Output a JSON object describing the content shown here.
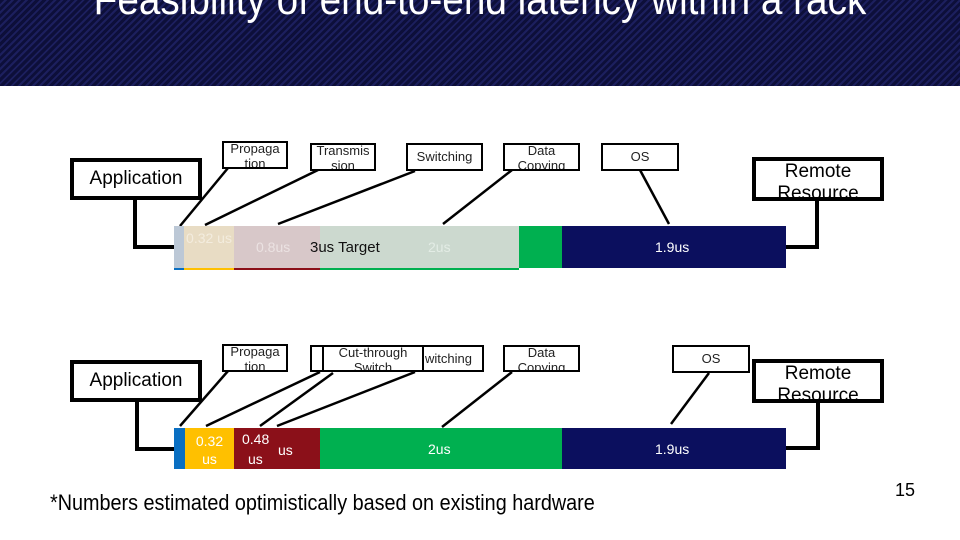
{
  "slide": {
    "title": "Feasibility of end-to-end latency within a rack",
    "footnote": "*Numbers estimated optimistically based on existing hardware",
    "page_number": "15"
  },
  "colors": {
    "title_bg_dark": "#0d0f3a",
    "title_bg_light": "#1c1f5e",
    "propagation": "#0a6fc2",
    "transmission": "#ffc000",
    "switching": "#8b1019",
    "data_copying": "#00b050",
    "os": "#0b0f5e"
  },
  "top_diagram": {
    "application_label": "Application",
    "remote_label": "Remote Resource",
    "callouts": {
      "propagation": "Propaga tion",
      "transmission": "Transmis sion",
      "switching": "Switching",
      "data_copying": "Data Copying",
      "os": "OS"
    },
    "segments": {
      "transmission": "0.32 us",
      "switching": "0.8us",
      "target_overlay": "3us Target",
      "data_copying": "2us",
      "os": "1.9us"
    }
  },
  "bottom_diagram": {
    "application_label": "Application",
    "remote_label": "Remote Resource",
    "callouts": {
      "propagation": "Propaga tion",
      "cut_through": "Cut-through Switch",
      "switching": "witching",
      "data_copying": "Data Copying",
      "os": "OS"
    },
    "segments": {
      "transmission_line1": "0.32",
      "transmission_line2": "us",
      "cut_through_line1": "0.48",
      "cut_through_line2": "us",
      "switching_residue": "us",
      "data_copying": "2us",
      "os": "1.9us"
    }
  }
}
